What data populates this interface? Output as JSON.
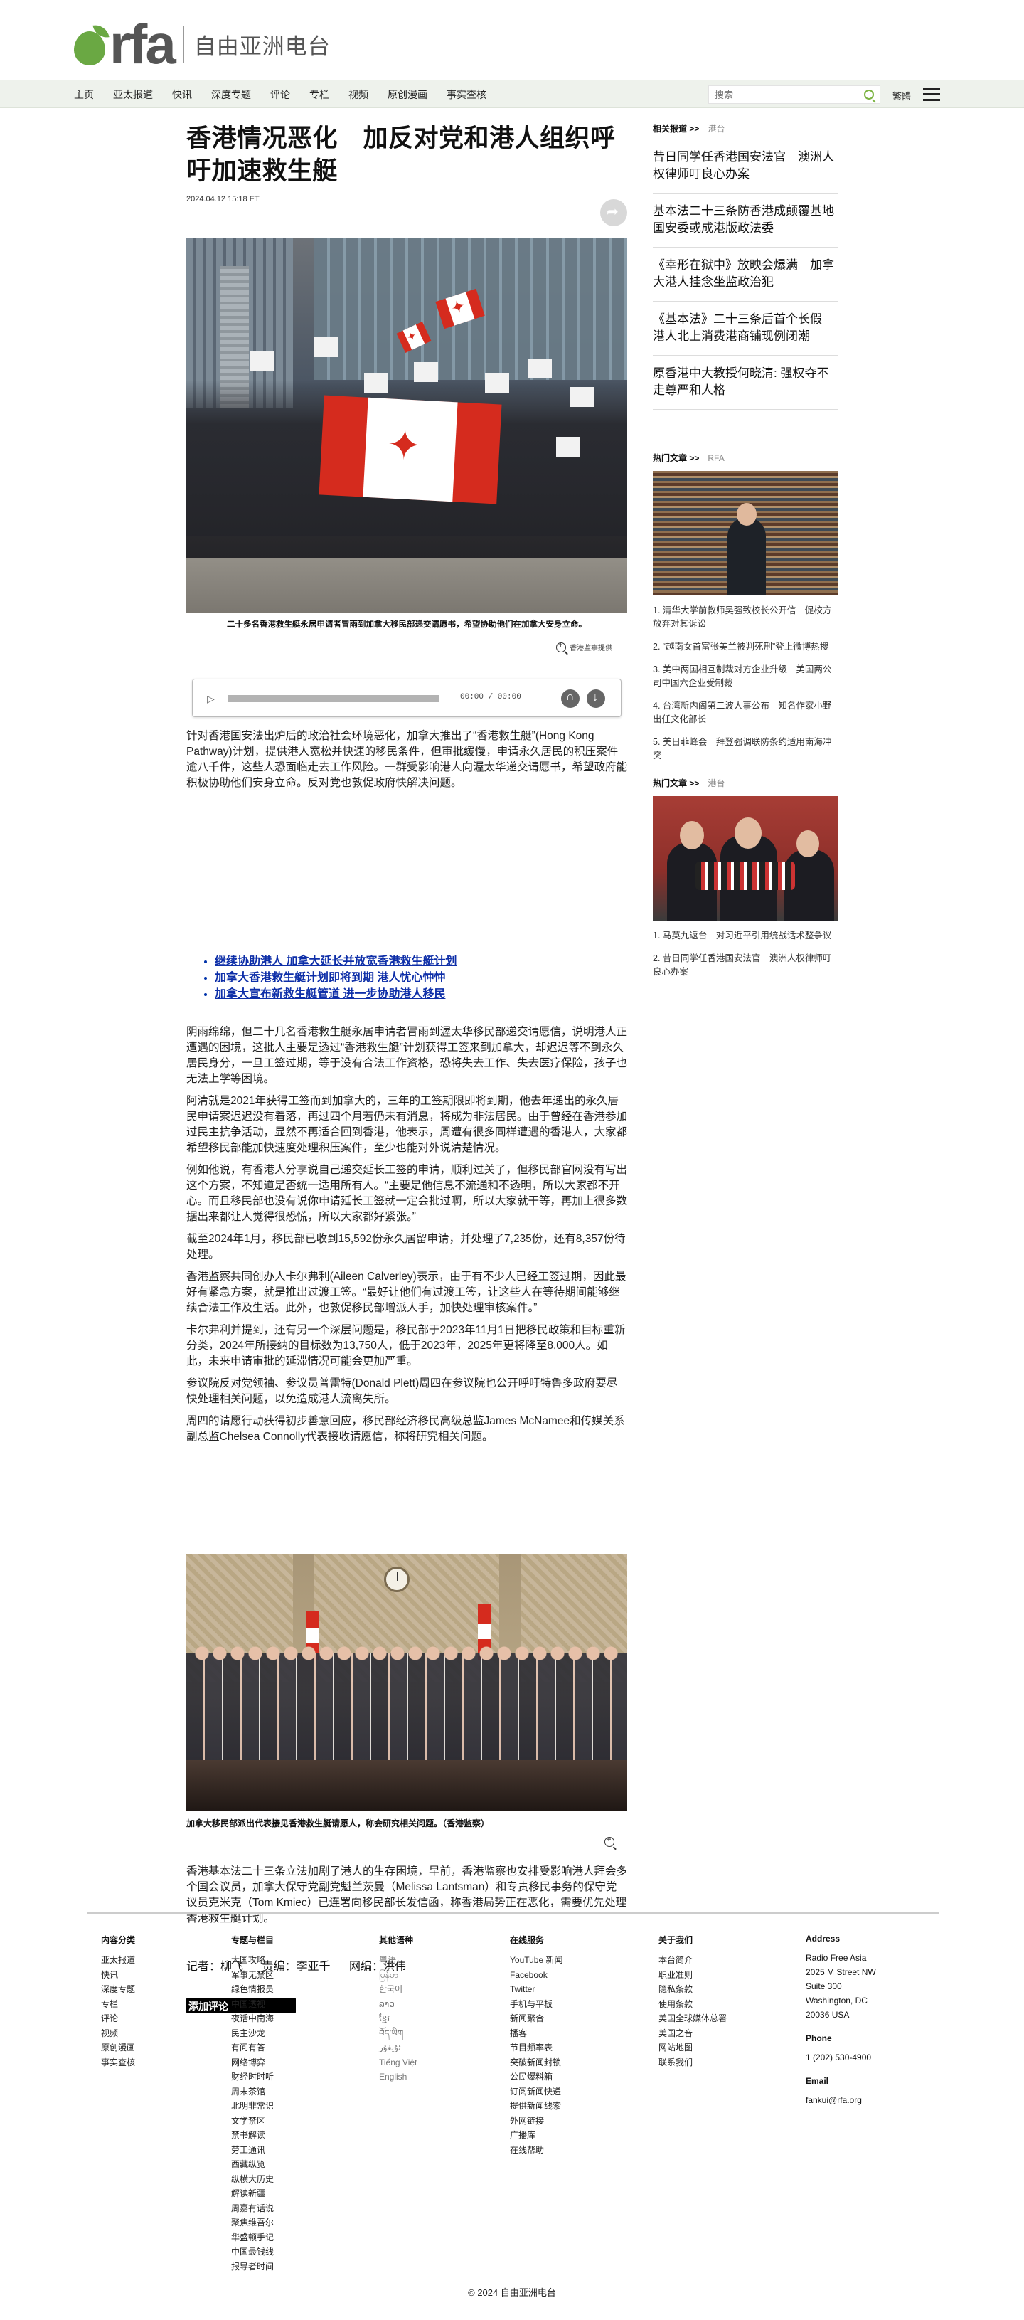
{
  "header": {
    "logo_text": "rfa",
    "logo_cn": "自由亚洲电台",
    "nav": [
      "主页",
      "亚太报道",
      "快讯",
      "深度专题",
      "评论",
      "专栏",
      "视频",
      "原创漫画",
      "事实查核"
    ],
    "search_placeholder": "搜索",
    "lang_switch": "繁體"
  },
  "article": {
    "headline": "香港情况恶化　加反对党和港人组织呼吁加速救生艇",
    "date": "2024.04.12 15:18 ET",
    "photo1_caption": "二十多名香港救生艇永居申请者冒雨到加拿大移民部递交请愿书，希望协助他们在加拿大安身立命。",
    "photo1_credit": "香港监察提供",
    "audio_time": "00:00 / 00:00",
    "intro": "针对香港国安法出炉后的政治社会环境恶化，加拿大推出了“香港救生艇”(Hong Kong Pathway)计划，提供港人宽松并快速的移民条件，但审批缓慢，申请永久居民的积压案件逾八千件，这些人恐面临走去工作风险。一群受影响港人向渥太华递交请愿书，希望政府能积极协助他们安身立命。反对党也敦促政府快解决问题。",
    "related_links": [
      "继续协助港人 加拿大延长并放宽香港救生艇计划",
      "加拿大香港救生艇计划即将到期 港人忧心忡忡",
      "加拿大宣布新救生艇管道 进一步协助港人移民"
    ],
    "paragraphs": [
      "阴雨绵绵，但二十几名香港救生艇永居申请者冒雨到渥太华移民部递交请愿信，说明港人正遭遇的困境，这批人主要是透过“香港救生艇”计划获得工签来到加拿大，却迟迟等不到永久居民身分，一旦工签过期，等于没有合法工作资格，恐将失去工作、失去医疗保险，孩子也无法上学等困境。",
      "阿清就是2021年获得工签而到加拿大的，三年的工签期限即将到期，他去年递出的永久居民申请案迟迟没有着落，再过四个月若仍未有消息，将成为非法居民。由于曾经在香港参加过民主抗争活动，显然不再适合回到香港，他表示，周遭有很多同样遭遇的香港人，大家都希望移民部能加快速度处理积压案件，至少也能对外说清楚情况。",
      "例如他说，有香港人分享说自己递交延长工签的申请，顺利过关了，但移民部官网没有写出这个方案，不知道是否统一适用所有人。“主要是他信息不流通和不透明，所以大家都不开心。而且移民部也没有说你申请延长工签就一定会批过啊，所以大家就干等，再加上很多数据出来都让人觉得很恐慌，所以大家都好紧张。”",
      "截至2024年1月，移民部已收到15,592份永久居留申请，并处理了7,235份，还有8,357份待处理。",
      "香港监察共同创办人卡尔弗利(Aileen Calverley)表示，由于有不少人已经工签过期，因此最好有紧急方案，就是推出过渡工签。“最好让他们有过渡工签，让这些人在等待期间能够继续合法工作及生活。此外，也敦促移民部增派人手，加快处理审核案件。”",
      "卡尔弗利并提到，还有另一个深层问题是，移民部于2023年11月1日把移民政策和目标重新分类，2024年所接纳的目标数为13,750人，低于2023年，2025年更将降至8,000人。如此，未来申请审批的延滞情况可能会更加严重。",
      "参议院反对党领袖、参议员普雷特(Donald Plett)周四在参议院也公开呼吁特鲁多政府要尽快处理相关问题，以免造成港人流离失所。",
      "周四的请愿行动获得初步善意回应，移民部经济移民高级总监James McNamee和传媒关系副总监Chelsea Connolly代表接收请愿信，称将研究相关问题。"
    ],
    "photo2_caption": "加拿大移民部派出代表接见香港救生艇请愿人，称会研究相关问题。（香港监察）",
    "closing": "香港基本法二十三条立法加剧了港人的生存困境，早前，香港监察也安排受影响港人拜会多个国会议员，加拿大保守党副党魁兰茨曼（Melissa Lantsman）和专责移民事务的保守党议员克米克（Tom Kmiec）已连署向移民部长发信函，称香港局势正在恶化，需要优先处理香港救生艇计划。",
    "credits": [
      "记者：柳飞",
      "责编：李亚千",
      "网编：洪伟"
    ],
    "comment_button": "添加评论"
  },
  "sidebar": {
    "related_head": "相关报道 >>",
    "related_sub": "港台",
    "related_items": [
      "昔日同学任香港国安法官　澳洲人权律师叮良心办案",
      "基本法二十三条防香港成颠覆基地　国安委或成港版政法委",
      "《幸形在狱中》放映会爆满　加拿大港人挂念坐监政治犯",
      "《基本法》二十三条后首个长假　港人北上消费港商铺现例闭潮",
      "原香港中大教授何晓清: 强权夺不走尊严和人格"
    ],
    "hot1_head": "热门文章 >>",
    "hot1_sub": "RFA",
    "hot1_items": [
      "1. 清华大学前教师吴强致校长公开信　促校方放弃对其诉讼",
      "2. “越南女首富张美兰被判死刑”登上微博热搜",
      "3. 美中两国相互制裁对方企业升级　美国两公司中国六企业受制裁",
      "4. 台湾新内阁第二波人事公布　知名作家小野出任文化部长",
      "5. 美日菲峰会　拜登强调联防条约适用南海冲突"
    ],
    "hot2_head": "热门文章 >>",
    "hot2_sub": "港台",
    "hot2_items": [
      "1. 马英九返台　对习近平引用统战话术整争议",
      "2. 昔日同学任香港国安法官　澳洲人权律师叮良心办案"
    ]
  },
  "footer": {
    "col1": {
      "title": "内容分类",
      "items": [
        "亚太报道",
        "快讯",
        "深度专题",
        "专栏",
        "评论",
        "视频",
        "原创漫画",
        "事实查核"
      ]
    },
    "col2": {
      "title": "专题与栏目",
      "items": [
        "大国攻略",
        "军事无禁区",
        "绿色情报员",
        "中国透视",
        "夜话中南海",
        "民主沙龙",
        "有问有答",
        "网络博弈",
        "财经时时听",
        "周末茶馆",
        "北明非常识",
        "文学禁区",
        "禁书解读",
        "劳工通讯",
        "西藏纵览",
        "纵横大历史",
        "解读新疆",
        "周嘉有话说",
        "聚焦维吾尔",
        "华盛顿手记",
        "中国最钱线",
        "报导者时间"
      ]
    },
    "col3": {
      "title": "其他语种",
      "items": [
        "粤语",
        "မြန်မာ",
        "한국어",
        "ລາວ",
        "ខ្មែរ",
        "བོད་ཡིག",
        "ئۇيغۇر",
        "Tiếng Việt",
        "English"
      ]
    },
    "col4": {
      "title": "在线服务",
      "items": [
        "YouTube 新闻",
        "Facebook",
        "Twitter",
        "手机与平板",
        "新闻聚合",
        "播客",
        "节目频率表",
        "突破新闻封锁",
        "公民爆料箱",
        "订阅新闻快递",
        "提供新闻线索",
        "外网链接",
        "广播库",
        "在线帮助"
      ]
    },
    "col5": {
      "title": "关于我们",
      "items": [
        "本台简介",
        "职业准则",
        "隐私条款",
        "使用条款",
        "美国全球媒体总署",
        "美国之音",
        "网站地图",
        "联系我们"
      ]
    },
    "address": {
      "title": "Address",
      "lines": [
        "Radio Free Asia",
        "2025 M Street NW",
        "Suite 300",
        "Washington, DC",
        "20036 USA"
      ],
      "phone_title": "Phone",
      "phone": "1 (202) 530-4900",
      "email_title": "Email",
      "email": "fankui@rfa.org"
    },
    "copyright": "© 2024 自由亚洲电台"
  }
}
